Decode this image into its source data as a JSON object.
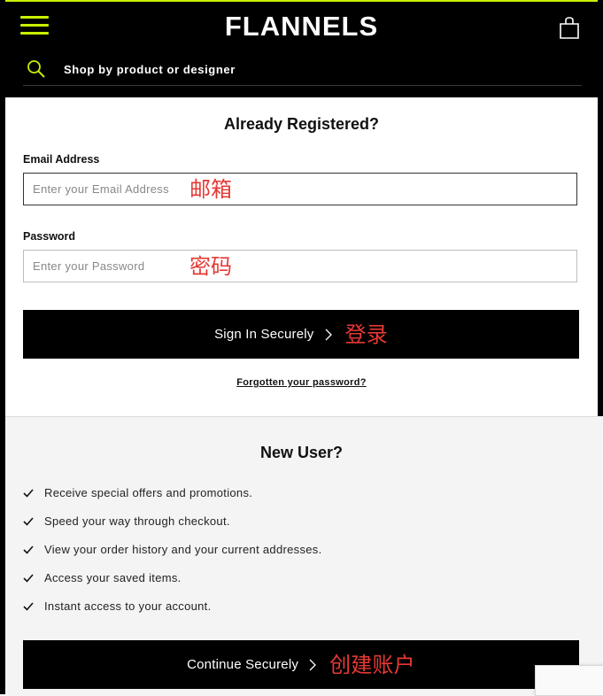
{
  "header": {
    "logo": "FLANNELS",
    "search_placeholder": "Shop by product or designer"
  },
  "login": {
    "title": "Already Registered?",
    "email_label": "Email Address",
    "email_placeholder": "Enter your Email Address",
    "email_annotation": "邮箱",
    "password_label": "Password",
    "password_placeholder": "Enter your Password",
    "password_annotation": "密码",
    "signin_label": "Sign In Securely",
    "signin_annotation": "登录",
    "forgot_label": "Forgotten your password?"
  },
  "new_user": {
    "title": "New User?",
    "benefits": [
      "Receive special offers and promotions.",
      "Speed your way through checkout.",
      "View your order history and your current addresses.",
      "Access your saved items.",
      "Instant access to your account."
    ],
    "continue_label": "Continue Securely",
    "continue_annotation": "创建账户"
  },
  "colors": {
    "accent": "#c8f000",
    "annotation": "#e53935",
    "button_bg": "#000000"
  },
  "icons": [
    "hamburger-menu-icon",
    "shopping-bag-icon",
    "search-icon",
    "chevron-right-icon",
    "checkmark-icon"
  ]
}
